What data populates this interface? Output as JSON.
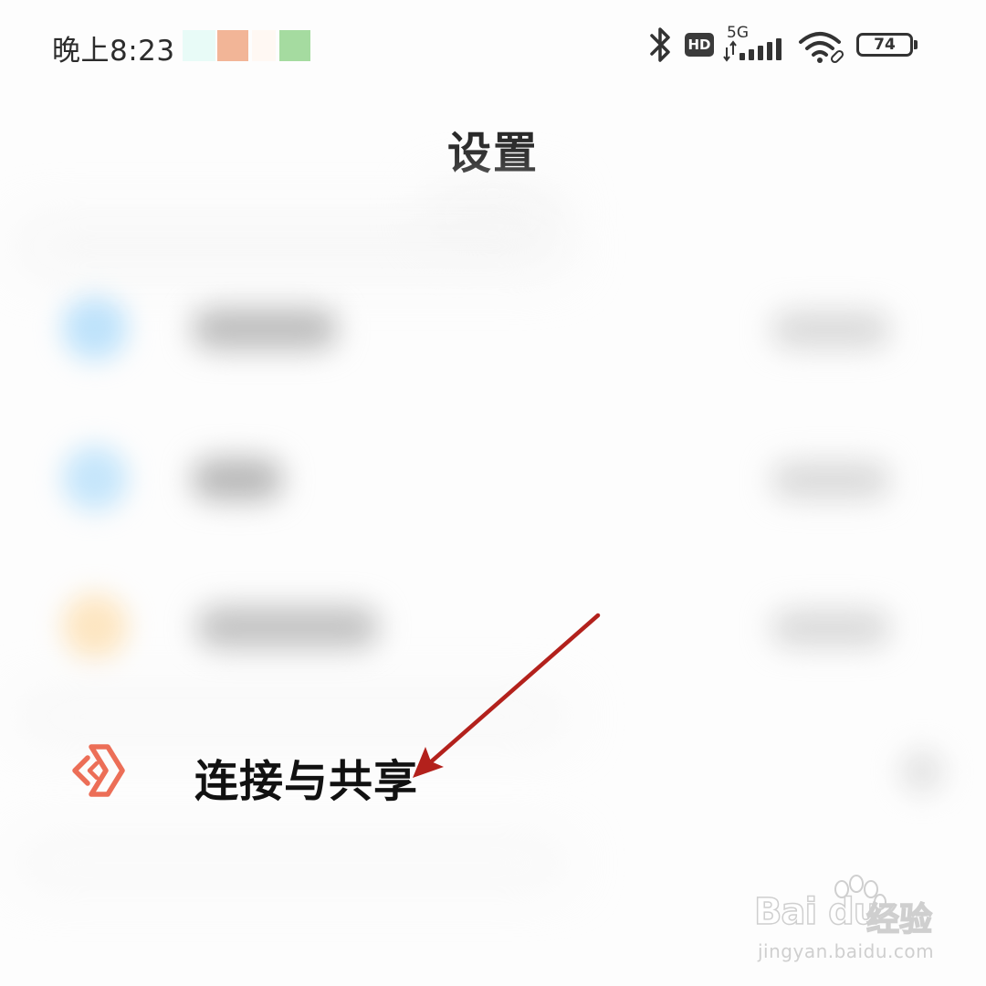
{
  "status_bar": {
    "time": "晚上8:23",
    "hd_badge": "HD",
    "network_type": "5G",
    "battery_level": "74",
    "icons": [
      "bluetooth-icon",
      "hd-icon",
      "cellular-signal-icon",
      "wifi-icon",
      "battery-icon"
    ],
    "notification_colors": [
      "#e8fbf7",
      "#f2b597",
      "#fff8f3",
      "#a5dba0"
    ]
  },
  "header": {
    "title": "设置"
  },
  "settings_list": {
    "highlighted_item": {
      "label": "连接与共享",
      "icon": "connection-sharing-icon",
      "icon_color": "#ec6e57"
    },
    "blurred_item_icon_colors": [
      "#bfe3fb",
      "#c6e6fb",
      "#fde6c2"
    ]
  },
  "annotation": {
    "arrow_color": "#b3211c"
  },
  "watermark": {
    "logo": "Bai du",
    "product": "经验",
    "url": "jingyan.baidu.com"
  }
}
